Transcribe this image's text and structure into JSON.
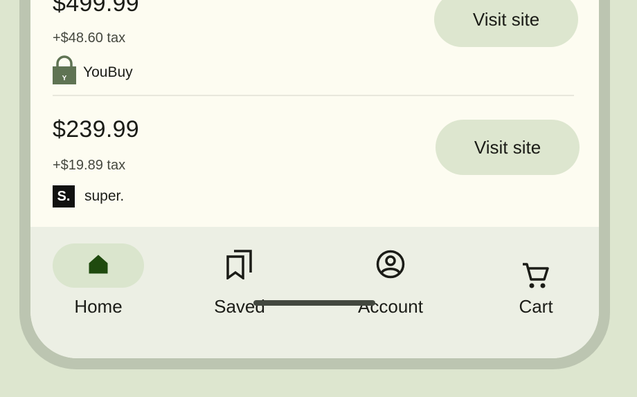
{
  "offers": [
    {
      "price": "$499.99",
      "tax": "+$48.60 tax",
      "merchant": "YouBuy",
      "merchant_logo": "Y",
      "button": "Visit site"
    },
    {
      "price": "$239.99",
      "tax": "+$19.89 tax",
      "merchant": "super.",
      "merchant_logo": "S.",
      "button": "Visit site"
    }
  ],
  "nav": {
    "home": "Home",
    "saved": "Saved",
    "account": "Account",
    "cart": "Cart",
    "active": "home"
  },
  "colors": {
    "background": "#dde6cf",
    "surface": "#fdfcf1",
    "nav_surface": "#ecefe4",
    "button": "#dde6cf",
    "active_indicator": "#dae5cd",
    "brand_green": "#5f7353",
    "home_icon": "#1f4a0e"
  },
  "icons": {
    "youbuy_logo": "padlock-bag-icon",
    "super_logo": "super-logo-icon",
    "home": "home-icon",
    "saved": "bookmarks-icon",
    "account": "account-circle-icon",
    "cart": "cart-icon"
  }
}
